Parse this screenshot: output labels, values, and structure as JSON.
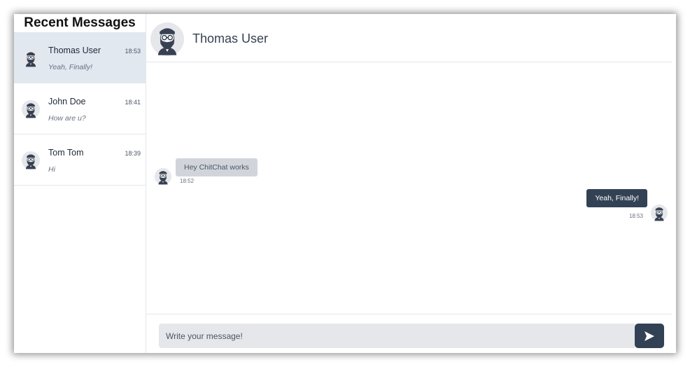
{
  "sidebar": {
    "title": "Recent Messages",
    "conversations": [
      {
        "name": "Thomas User",
        "preview": "Yeah, Finally!",
        "time": "18:53",
        "active": true
      },
      {
        "name": "John Doe",
        "preview": "How are u?",
        "time": "18:41",
        "active": false
      },
      {
        "name": "Tom Tom",
        "preview": "Hi",
        "time": "18:39",
        "active": false
      }
    ]
  },
  "chat": {
    "title": "Thomas User",
    "messages": [
      {
        "direction": "incoming",
        "text": "Hey ChitChat works",
        "time": "18:52"
      },
      {
        "direction": "outgoing",
        "text": "Yeah, Finally!",
        "time": "18:53"
      }
    ]
  },
  "composer": {
    "placeholder": "Write your message!",
    "value": "",
    "send_icon": "send-arrow-icon"
  },
  "colors": {
    "active_conversation": "#e2e8f0",
    "outgoing_bubble": "#334155",
    "incoming_bubble": "#d1d5db",
    "send_button": "#334155"
  },
  "avatar_icon": "bearded-man-avatar-icon"
}
